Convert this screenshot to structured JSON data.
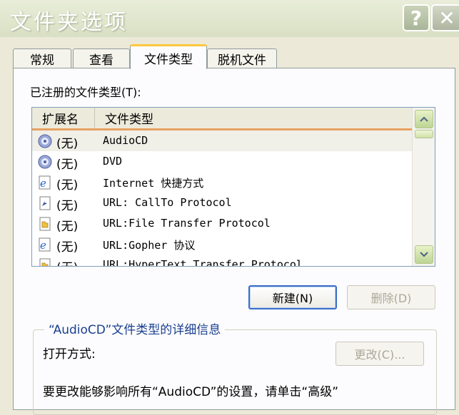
{
  "window": {
    "title": "文件夹选项",
    "help_label": "?",
    "close_label": "✕"
  },
  "tabs": [
    {
      "label": "常规"
    },
    {
      "label": "查看"
    },
    {
      "label": "文件类型",
      "active": true
    },
    {
      "label": "脱机文件"
    }
  ],
  "registered_label": "已注册的文件类型(T):",
  "list": {
    "columns": {
      "extension": "扩展名",
      "file_type": "文件类型"
    },
    "rows": [
      {
        "ext": "(无)",
        "type": "AudioCD",
        "icon": "audio-cd-icon",
        "selected": true
      },
      {
        "ext": "(无)",
        "type": "DVD",
        "icon": "dvd-icon"
      },
      {
        "ext": "(无)",
        "type": "Internet 快捷方式",
        "icon": "internet-explorer-icon"
      },
      {
        "ext": "(无)",
        "type": "URL: CallTo Protocol",
        "icon": "url-protocol-icon"
      },
      {
        "ext": "(无)",
        "type": "URL:File Transfer Protocol",
        "icon": "url-folder-icon"
      },
      {
        "ext": "(无)",
        "type": "URL:Gopher 协议",
        "icon": "internet-explorer-icon"
      },
      {
        "ext": "(无)",
        "type": "URL:HyperText Transfer Protocol",
        "icon": "url-folder-icon"
      }
    ]
  },
  "buttons": {
    "new": "新建(N)",
    "delete": "删除(D)",
    "change": "更改(C)..."
  },
  "details": {
    "legend": "“AudioCD”文件类型的详细信息",
    "open_with_label": "打开方式:",
    "hint": "要更改能够影响所有“AudioCD”的设置，请单击“高级”"
  },
  "colors": {
    "window_bg": "#ece9d8",
    "panel_bg": "#fcfcfe",
    "active_tab_accent": "#ffc83c",
    "header_sort_accent": "#e8a060",
    "legend_text": "#1a3f8f",
    "default_button_border": "#3c6ec8"
  }
}
